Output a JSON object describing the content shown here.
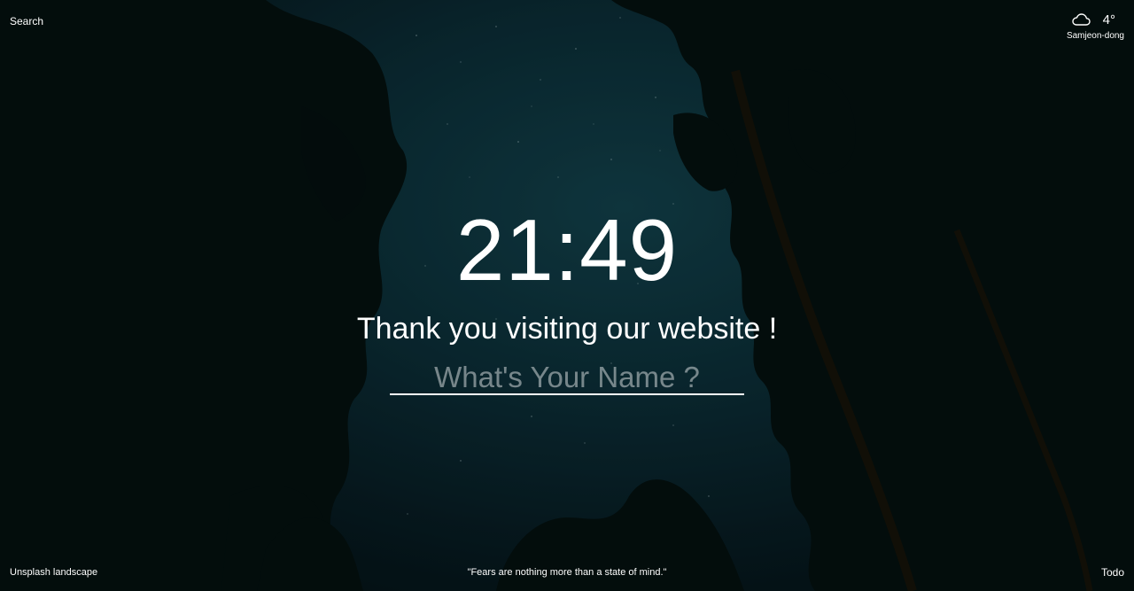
{
  "background": {
    "sky_color": "#0b2d36",
    "tree_color": "#030a0c"
  },
  "header": {
    "search_label": "Search"
  },
  "weather": {
    "icon": "cloud-icon",
    "temperature": "4°",
    "location": "Samjeon-dong"
  },
  "clock": {
    "time": "21:49"
  },
  "greeting": {
    "text": "Thank you visiting our website !"
  },
  "name_field": {
    "value": "",
    "placeholder": "What's Your Name ?"
  },
  "footer": {
    "photo_credit": "Unsplash landscape",
    "quote": "\"Fears are nothing more than a state of mind.\"",
    "todo_label": "Todo"
  }
}
